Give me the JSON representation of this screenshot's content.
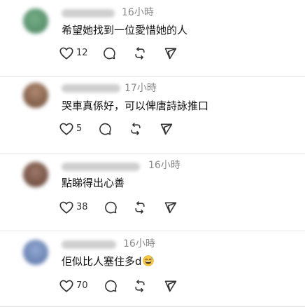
{
  "replies": [
    {
      "avatar_color": "#5a9470",
      "timestamp": "16小時",
      "text": "希望她找到一位愛惜她的人",
      "like_count": "12"
    },
    {
      "avatar_color": "#8a6a52",
      "timestamp": "17小時",
      "text": "哭車真係好，可以俾唐詩詠推口",
      "like_count": "5"
    },
    {
      "avatar_color": "#7a5a48",
      "timestamp": "16小時",
      "text": "點睇得出心善",
      "like_count": "38"
    },
    {
      "avatar_color": "#6d86b5",
      "timestamp": "16小時",
      "text": "佢似比人塞住多d",
      "like_count": "70",
      "emoji": "grinning-sweat-emoji"
    }
  ],
  "icons": {
    "like": "heart-icon",
    "reply": "comment-icon",
    "repost": "repost-icon",
    "share": "send-icon"
  }
}
